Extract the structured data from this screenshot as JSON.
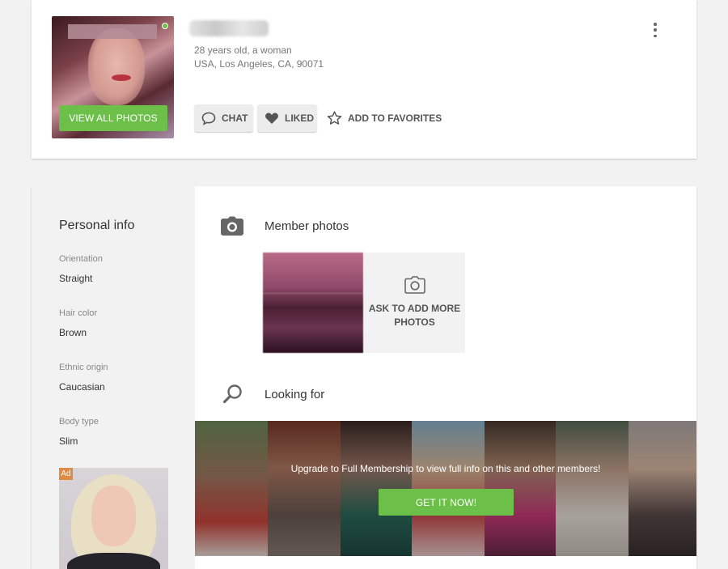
{
  "profile": {
    "age_gender": "28 years old, a woman",
    "location": "USA, Los Angeles, CA, 90071",
    "view_photos_label": "VIEW ALL PHOTOS",
    "actions": {
      "chat_label": "CHAT",
      "liked_label": "LIKED",
      "favorites_label": "ADD TO FAVORITES"
    }
  },
  "sidebar": {
    "title": "Personal info",
    "fields": [
      {
        "label": "Orientation",
        "value": "Straight"
      },
      {
        "label": "Hair color",
        "value": "Brown"
      },
      {
        "label": "Ethnic origin",
        "value": "Caucasian"
      },
      {
        "label": "Body type",
        "value": "Slim"
      }
    ],
    "ad_badge": "Ad"
  },
  "main": {
    "photos_title": "Member photos",
    "ask_more_label": "ASK TO ADD MORE PHOTOS",
    "looking_for_title": "Looking for",
    "banner_text": "Upgrade to Full Membership to view full info on this and other members!",
    "banner_button": "GET IT NOW!"
  },
  "colors": {
    "accent_green": "#6cc04a",
    "online": "#6cc04a",
    "ad_badge": "#e08b43"
  },
  "icons": [
    "kebab-menu-icon",
    "chat-bubble-icon",
    "heart-icon",
    "star-icon",
    "camera-icon",
    "search-icon"
  ]
}
